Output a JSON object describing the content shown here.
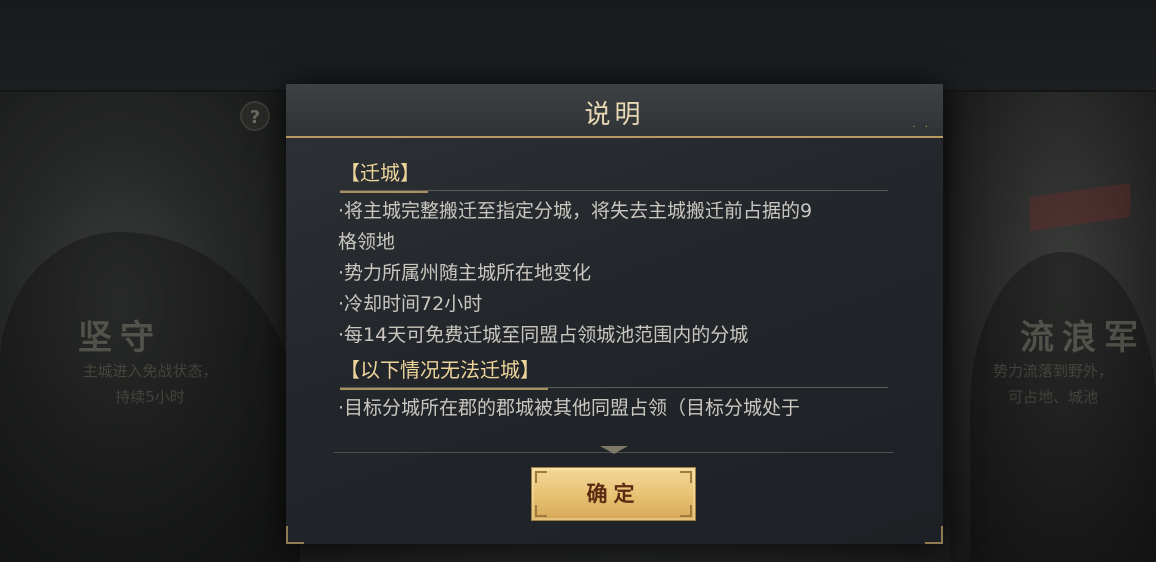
{
  "background": {
    "left_title": "坚守",
    "left_desc_1": "主城进入免战状态，",
    "left_desc_2": "持续5小时",
    "right_title": "流浪军",
    "right_desc_1": "势力流落到野外，",
    "right_desc_2": "可占地、城池"
  },
  "dialog": {
    "title": "说明",
    "sections": [
      {
        "heading": "【迁城】",
        "lines": [
          "·将主城完整搬迁至指定分城，将失去主城搬迁前占据的9",
          "格领地",
          "·势力所属州随主城所在地变化",
          "·冷却时间72小时",
          "·每14天可免费迁城至同盟占领城池范围内的分城"
        ]
      },
      {
        "heading": "【以下情况无法迁城】",
        "lines": [
          "·目标分城所在郡的郡城被其他同盟占领（目标分城处于"
        ]
      }
    ],
    "confirm_label": "确定"
  },
  "colors": {
    "accent_gold": "#e8c072",
    "heading_text": "#ecd49a",
    "body_text": "#c9c6bf"
  },
  "icons": {
    "help": "question-mark-icon"
  }
}
